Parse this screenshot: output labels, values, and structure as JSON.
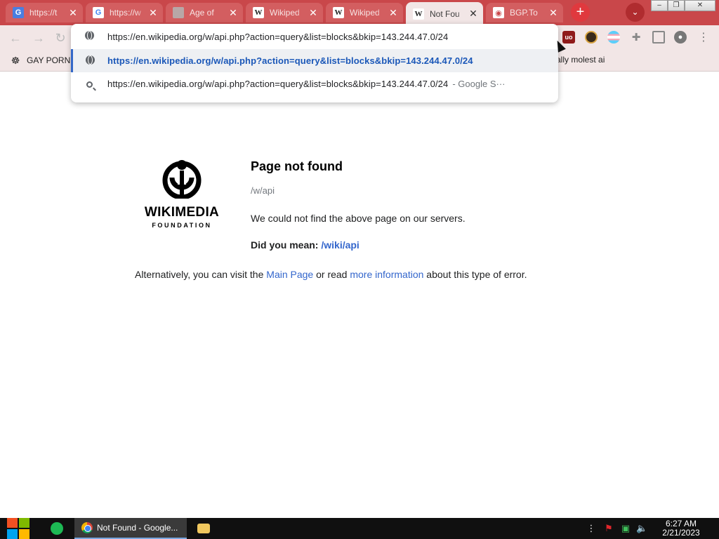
{
  "browser": {
    "tabs": [
      {
        "title": "https://t",
        "favicon": "google-translate-icon",
        "active": false
      },
      {
        "title": "https://w",
        "favicon": "google-icon",
        "active": false
      },
      {
        "title": "Age of",
        "favicon": "globe-icon",
        "active": false
      },
      {
        "title": "Wikiped",
        "favicon": "wikipedia-icon",
        "active": false
      },
      {
        "title": "Wikiped",
        "favicon": "wikipedia-icon",
        "active": false
      },
      {
        "title": "Not Fou",
        "favicon": "wikipedia-icon",
        "active": true
      },
      {
        "title": "BGP.To",
        "favicon": "bgp-icon",
        "active": false
      }
    ],
    "new_tab": "+",
    "omnibox": {
      "input": "https://en.wikipedia.org/w/api.php?action=query&list=blocks&bkip=143.244.47.0/24",
      "suggestions": [
        {
          "text": "https://en.wikipedia.org/w/api.php?action=query&list=blocks&bkip=143.244.47.0/24",
          "icon": "globe-icon",
          "suffix": ""
        },
        {
          "text": "https://en.wikipedia.org/w/api.php?action=query&list=blocks&bkip=143.244.47.0/24",
          "icon": "search-icon",
          "suffix": "- Google S···"
        }
      ]
    },
    "bookmarks": [
      {
        "label": "GAY PORN",
        "icon": "bookmark-icon"
      },
      {
        "label": "ally molest ai",
        "icon": ""
      }
    ]
  },
  "page": {
    "logo_word": "WIKIMEDIA",
    "logo_sub": "FOUNDATION",
    "heading": "Page not found",
    "path": "/w/api",
    "message": "We could not find the above page on our servers.",
    "did_you_mean_label": "Did you mean:",
    "did_you_mean_link": "/wiki/api",
    "alt_prefix": "Alternatively, you can visit the",
    "alt_link1": "Main Page",
    "alt_middle": "or read",
    "alt_link2": "more information",
    "alt_suffix": "about this type of error."
  },
  "taskbar": {
    "app_label": "Not Found - Google...",
    "time": "6:27 AM",
    "date": "2/21/2023"
  },
  "colors": {
    "tabstrip": "#c9474a",
    "toolbar": "#f2e6e6",
    "link": "#3366cc"
  }
}
